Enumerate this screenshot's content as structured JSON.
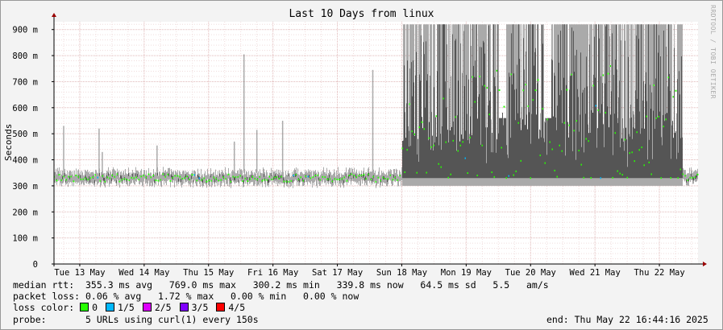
{
  "chart_data": {
    "type": "line",
    "title": "Last 10 Days from linux",
    "xlabel": "",
    "ylabel": "Seconds",
    "y_unit": "ms",
    "ylim": [
      0,
      930
    ],
    "yticks": [
      0,
      100,
      200,
      300,
      400,
      500,
      600,
      700,
      800,
      900
    ],
    "ytick_labels": [
      "0",
      "100 m",
      "200 m",
      "300 m",
      "400 m",
      "500 m",
      "600 m",
      "700 m",
      "800 m",
      "900 m"
    ],
    "xlim_days": [
      12.6,
      22.6
    ],
    "xticks": [
      {
        "label": "Tue 13 May",
        "day": 13
      },
      {
        "label": "Wed 14 May",
        "day": 14
      },
      {
        "label": "Thu 15 May",
        "day": 15
      },
      {
        "label": "Fri 16 May",
        "day": 16
      },
      {
        "label": "Sat 17 May",
        "day": 17
      },
      {
        "label": "Sun 18 May",
        "day": 18
      },
      {
        "label": "Mon 19 May",
        "day": 19
      },
      {
        "label": "Tue 20 May",
        "day": 20
      },
      {
        "label": "Wed 21 May",
        "day": 21
      },
      {
        "label": "Thu 22 May",
        "day": 22
      }
    ],
    "grid": true,
    "series": [
      {
        "name": "median rtt",
        "stable_level": 330,
        "from_day": 12.6,
        "to_day": 22.6
      },
      {
        "name": "smoke spikes",
        "points": [
          {
            "day": 12.75,
            "value": 530
          },
          {
            "day": 13.3,
            "value": 520
          },
          {
            "day": 13.35,
            "value": 430
          },
          {
            "day": 14.2,
            "value": 455
          },
          {
            "day": 15.4,
            "value": 470
          },
          {
            "day": 15.55,
            "value": 805
          },
          {
            "day": 15.75,
            "value": 515
          },
          {
            "day": 16.15,
            "value": 550
          },
          {
            "day": 17.55,
            "value": 745
          }
        ]
      },
      {
        "name": "unstable period",
        "from_day": 18.0,
        "to_day": 22.35,
        "median_range": [
          330,
          760
        ],
        "smoke_max": 920
      }
    ]
  },
  "stats": {
    "median_rtt": "median rtt:  355.3 ms avg   769.0 ms max   300.2 ms min   339.8 ms now   64.5 ms sd   5.5   am/s",
    "packet_loss": "packet loss: 0.06 % avg   1.72 % max   0.00 % min   0.00 % now",
    "loss_color_label": "loss color: ",
    "loss_colors": [
      {
        "label": "0",
        "color": "#26ff00"
      },
      {
        "label": "1/5",
        "color": "#00b8ff"
      },
      {
        "label": "2/5",
        "color": "#dd00ff"
      },
      {
        "label": "3/5",
        "color": "#8000ff"
      },
      {
        "label": "4/5",
        "color": "#ff0000"
      }
    ],
    "probe": "probe:       5 URLs using curl(1) every 150s",
    "end": "end: Thu May 22 16:44:16 2025"
  },
  "watermark": "RRDTOOL / TOBI OETIKER",
  "colors": {
    "background": "#f3f3f3",
    "plot": "#ffffff",
    "grid": "#e0b8b8",
    "smoke_light": "#aaaaaa",
    "smoke_dark": "#555555",
    "axis": "#000000",
    "arrow": "#990000"
  }
}
